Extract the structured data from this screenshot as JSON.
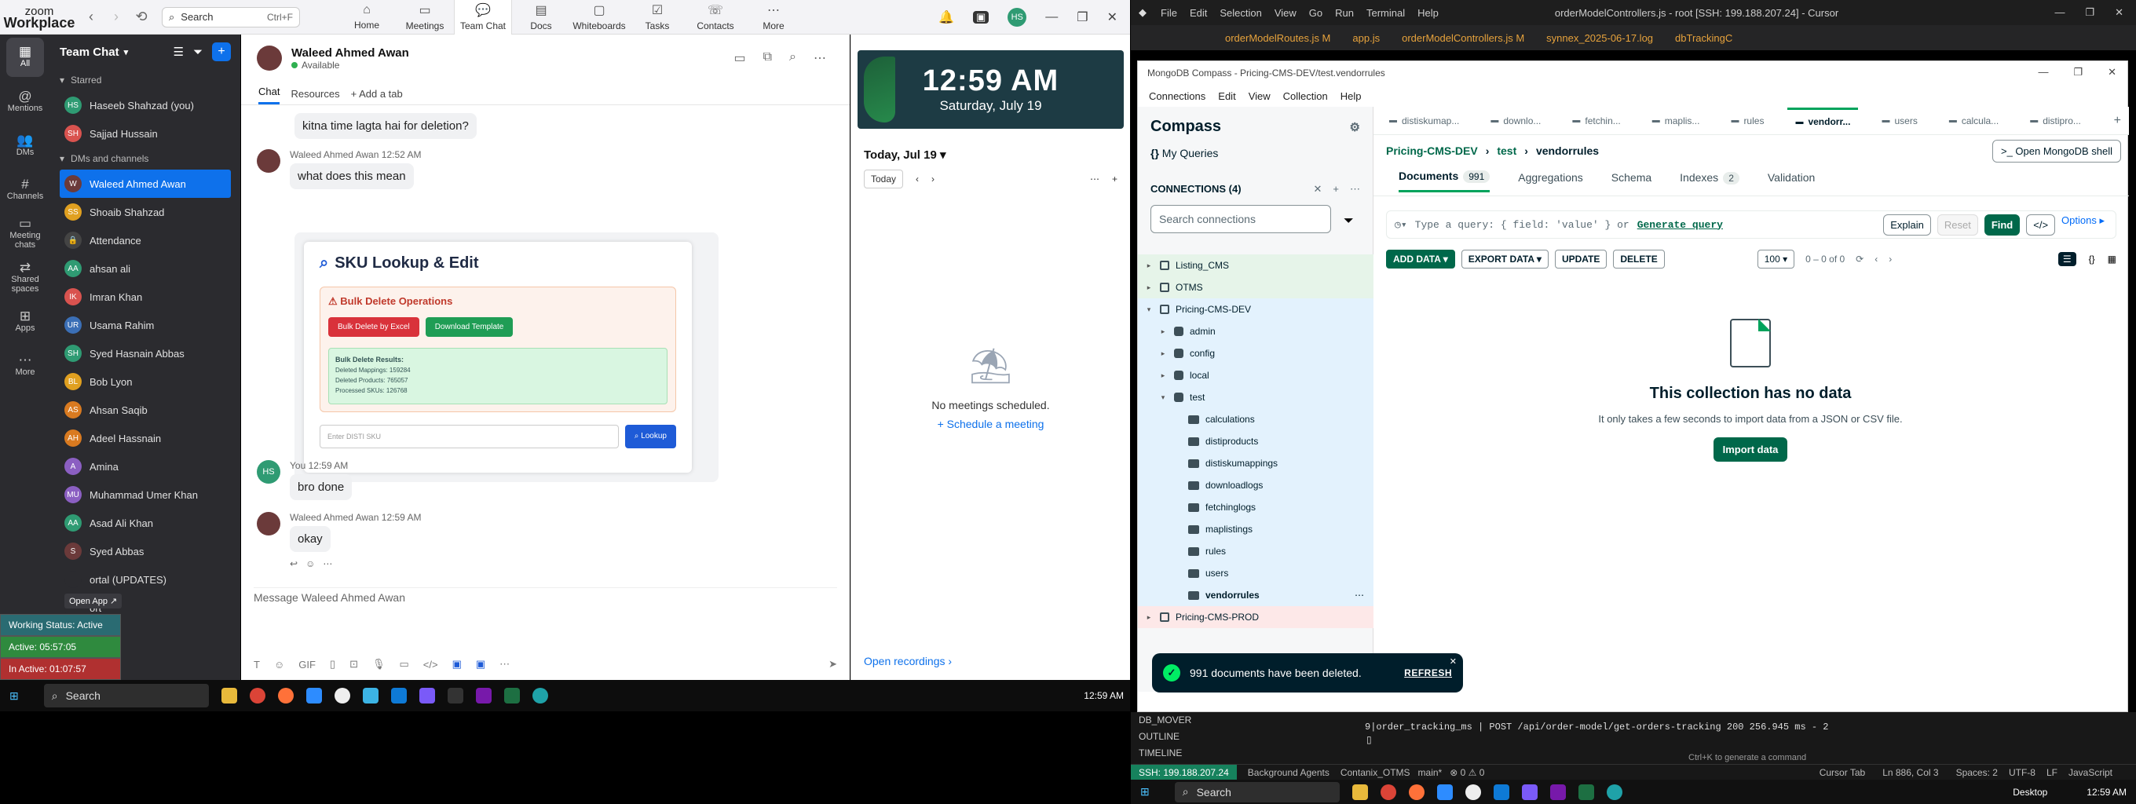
{
  "zoom": {
    "logo_line1": "zoom",
    "logo_line2": "Workplace",
    "search_label": "Search",
    "search_shortcut": "Ctrl+F",
    "tabs": [
      {
        "label": "Home",
        "icon": "home-icon"
      },
      {
        "label": "Meetings",
        "icon": "video-icon"
      },
      {
        "label": "Team Chat",
        "icon": "chat-icon"
      },
      {
        "label": "Docs",
        "icon": "docs-icon"
      },
      {
        "label": "Whiteboards",
        "icon": "whiteboard-icon"
      },
      {
        "label": "Tasks",
        "icon": "tasks-icon"
      },
      {
        "label": "Contacts",
        "icon": "contacts-icon"
      },
      {
        "label": "More",
        "icon": "more-icon"
      }
    ],
    "user_initials": "HS",
    "rail": [
      {
        "label": "All"
      },
      {
        "label": "Mentions"
      },
      {
        "label": "DMs"
      },
      {
        "label": "Channels"
      },
      {
        "label": "Meeting chats"
      },
      {
        "label": "Shared spaces"
      },
      {
        "label": "Apps"
      },
      {
        "label": "More"
      }
    ],
    "panel_title": "Team Chat",
    "sections": {
      "starred": "Starred",
      "dms": "DMs and channels"
    },
    "starred": [
      {
        "name": "Haseeb Shahzad (you)",
        "initials": "HS",
        "color": "#2f9b73"
      },
      {
        "name": "Sajjad Hussain",
        "initials": "SH",
        "color": "#d9534f"
      }
    ],
    "contacts": [
      {
        "name": "Waleed Ahmed Awan",
        "initials": "W",
        "color": "#6b3a3a"
      },
      {
        "name": "Shoaib Shahzad",
        "initials": "SS",
        "color": "#e0a020"
      },
      {
        "name": "Attendance",
        "initials": "🔒",
        "color": "#444"
      },
      {
        "name": "ahsan ali",
        "initials": "AA",
        "color": "#2f9b73"
      },
      {
        "name": "Imran Khan",
        "initials": "IK",
        "color": "#d9534f"
      },
      {
        "name": "Usama Rahim",
        "initials": "UR",
        "color": "#3b6fb6"
      },
      {
        "name": "Syed Hasnain Abbas",
        "initials": "SH",
        "color": "#2f9b73"
      },
      {
        "name": "Bob Lyon",
        "initials": "BL",
        "color": "#e0a020"
      },
      {
        "name": "Ahsan Saqib",
        "initials": "AS",
        "color": "#d97a20"
      },
      {
        "name": "Adeel Hassnain",
        "initials": "AH",
        "color": "#d97a20"
      },
      {
        "name": "Amina",
        "initials": "A",
        "color": "#8b5fc2"
      },
      {
        "name": "Muhammad Umer Khan",
        "initials": "MU",
        "color": "#8b5fc2"
      },
      {
        "name": "Asad Ali Khan",
        "initials": "AA",
        "color": "#2f9b73"
      },
      {
        "name": "Syed Abbas",
        "initials": "S",
        "color": "#6b3a3a"
      },
      {
        "name": "ortal (UPDATES)",
        "initials": "",
        "color": "#2b2b2f"
      },
      {
        "name": "ort",
        "initials": "",
        "color": "#2b2b2f"
      },
      {
        "name": "ates",
        "initials": "",
        "color": "#2b2b2f"
      }
    ],
    "open_app": "Open App ↗",
    "work_status": {
      "status": "Working Status: Active",
      "active": "Active: 05:57:05",
      "inactive": "In Active: 01:07:57"
    },
    "chat": {
      "name": "Waleed Ahmed Awan",
      "status": "Available",
      "tabs": [
        "Chat",
        "Resources",
        "+ Add a tab"
      ],
      "msg1": "kitna time lagta hai for deletion?",
      "sender1": "Waleed Ahmed Awan",
      "time1": "12:52 AM",
      "msg2": "what does this mean",
      "sku": {
        "title": "SKU Lookup & Edit",
        "bulk_title": "Bulk Delete Operations",
        "btn_delete": "Bulk Delete by Excel",
        "btn_download": "Download Template",
        "results_title": "Bulk Delete Results:",
        "r1": "Deleted Mappings: 159284",
        "r2": "Deleted Products: 765057",
        "r3": "Processed SKUs: 126768",
        "input_placeholder": "Enter DISTI SKU",
        "lookup": "Lookup"
      },
      "me_sender": "You",
      "me_time": "12:59 AM",
      "msg3": "bro done",
      "time3": "12:59 AM",
      "msg4": "okay",
      "composer_placeholder": "Message Waleed Ahmed Awan",
      "gif": "GIF"
    },
    "calendar": {
      "time": "12:59 AM",
      "date": "Saturday, July 19",
      "day_header": "Today, Jul 19",
      "today_btn": "Today",
      "empty": "No meetings scheduled.",
      "schedule": "+ Schedule a meeting",
      "open_recordings": "Open recordings ›"
    },
    "taskbar": {
      "search": "Search",
      "time": "12:59 AM"
    }
  },
  "cursor": {
    "menu": [
      "File",
      "Edit",
      "Selection",
      "View",
      "Go",
      "Run",
      "Terminal",
      "Help"
    ],
    "title": "orderModelControllers.js - root [SSH: 199.188.207.24] - Cursor",
    "tabs": [
      "orderModelRoutes.js M",
      "app.js",
      "orderModelControllers.js M",
      "synnex_2025-06-17.log",
      "dbTrackingC"
    ],
    "terminal_line": "9|order_tracking_ms  | POST /api/order-model/get-orders-tracking 200 256.945 ms - 2",
    "terminal_hint": "Ctrl+K to generate a command",
    "sidebar_items": [
      "DB_MOVER",
      "OUTLINE",
      "TIMELINE"
    ],
    "status": {
      "ssh": "SSH: 199.188.207.24",
      "agents": "Background Agents",
      "repo": "Contanix_OTMS",
      "branch": "main*",
      "problems": "⊗ 0 ⚠ 0",
      "tab": "Cursor Tab",
      "pos": "Ln 886, Col 3",
      "spaces": "Spaces: 2",
      "enc": "UTF-8",
      "eol": "LF",
      "lang": "JavaScript"
    },
    "taskbar": {
      "search": "Search",
      "desktop": "Desktop",
      "time": "12:59 AM"
    }
  },
  "compass": {
    "title": "MongoDB Compass - Pricing-CMS-DEV/test.vendorrules",
    "menu": [
      "Connections",
      "Edit",
      "View",
      "Collection",
      "Help"
    ],
    "app_name": "Compass",
    "my_queries": "My Queries",
    "connections_header": "CONNECTIONS (4)",
    "search_placeholder": "Search connections",
    "connections": [
      "Listing_CMS",
      "OTMS",
      "Pricing-CMS-DEV",
      "Pricing-CMS-PROD"
    ],
    "databases": [
      "admin",
      "config",
      "local",
      "test"
    ],
    "collections": [
      "calculations",
      "distiproducts",
      "distiskumappings",
      "downloadlogs",
      "fetchinglogs",
      "maplistings",
      "rules",
      "users",
      "vendorrules"
    ],
    "tabs": [
      "distiskumap...",
      "downlo...",
      "fetchin...",
      "maplis...",
      "rules",
      "vendorr...",
      "users",
      "calcula...",
      "distipro..."
    ],
    "crumb": {
      "conn": "Pricing-CMS-DEV",
      "db": "test",
      "coll": "vendorrules",
      "shell": ">_ Open MongoDB shell"
    },
    "subtabs": {
      "documents": "Documents",
      "doc_count": "991",
      "aggregations": "Aggregations",
      "schema": "Schema",
      "indexes": "Indexes",
      "index_count": "2",
      "validation": "Validation"
    },
    "query_placeholder": "Type a query: { field: 'value' } or",
    "generate_query": "Generate query",
    "buttons": {
      "explain": "Explain",
      "reset": "Reset",
      "find": "Find",
      "options": "Options ▸"
    },
    "actions": {
      "add": "ADD DATA ▾",
      "export": "EXPORT DATA ▾",
      "update": "UPDATE",
      "delete": "DELETE"
    },
    "page_size": "100 ▾",
    "range": "0 – 0 of 0",
    "empty_title": "This collection has no data",
    "empty_desc": "It only takes a few seconds to import data from a JSON or CSV file.",
    "import": "Import data",
    "toast": "991 documents have been deleted.",
    "toast_action": "REFRESH"
  }
}
